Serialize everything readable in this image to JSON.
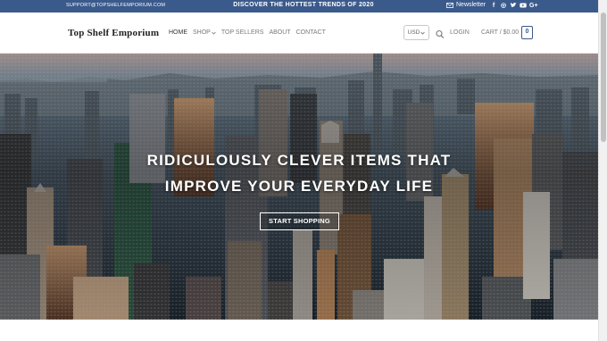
{
  "announcement": {
    "email": "SUPPORT@TOPSHELFEMPORIUM.COM",
    "promo": "DISCOVER THE HOTTEST TRENDS OF 2020",
    "newsletter": "Newsletter",
    "socials": [
      {
        "name": "facebook-icon",
        "glyph": "f"
      },
      {
        "name": "instagram-icon",
        "glyph": "◎"
      },
      {
        "name": "twitter-icon",
        "glyph": "🐦"
      },
      {
        "name": "youtube-icon",
        "glyph": "▶"
      },
      {
        "name": "google-plus-icon",
        "glyph": "G+"
      }
    ]
  },
  "header": {
    "logo": "Top Shelf Emporium",
    "nav": [
      {
        "label": "HOME",
        "active": true,
        "dropdown": false
      },
      {
        "label": "SHOP",
        "active": false,
        "dropdown": true
      },
      {
        "label": "TOP SELLERS",
        "active": false,
        "dropdown": false
      },
      {
        "label": "ABOUT",
        "active": false,
        "dropdown": false
      },
      {
        "label": "CONTACT",
        "active": false,
        "dropdown": false
      }
    ],
    "currency": "USD",
    "login": "LOGIN",
    "cart": "CART / $0.00",
    "cart_count": "0"
  },
  "hero": {
    "title_line1": "RIDICULOUSLY CLEVER ITEMS THAT",
    "title_line2": "IMPROVE YOUR EVERYDAY LIFE",
    "button": "START SHOPPING"
  },
  "colors": {
    "brand": "#3b5a8c",
    "hero_sky": "#8b9cab"
  }
}
